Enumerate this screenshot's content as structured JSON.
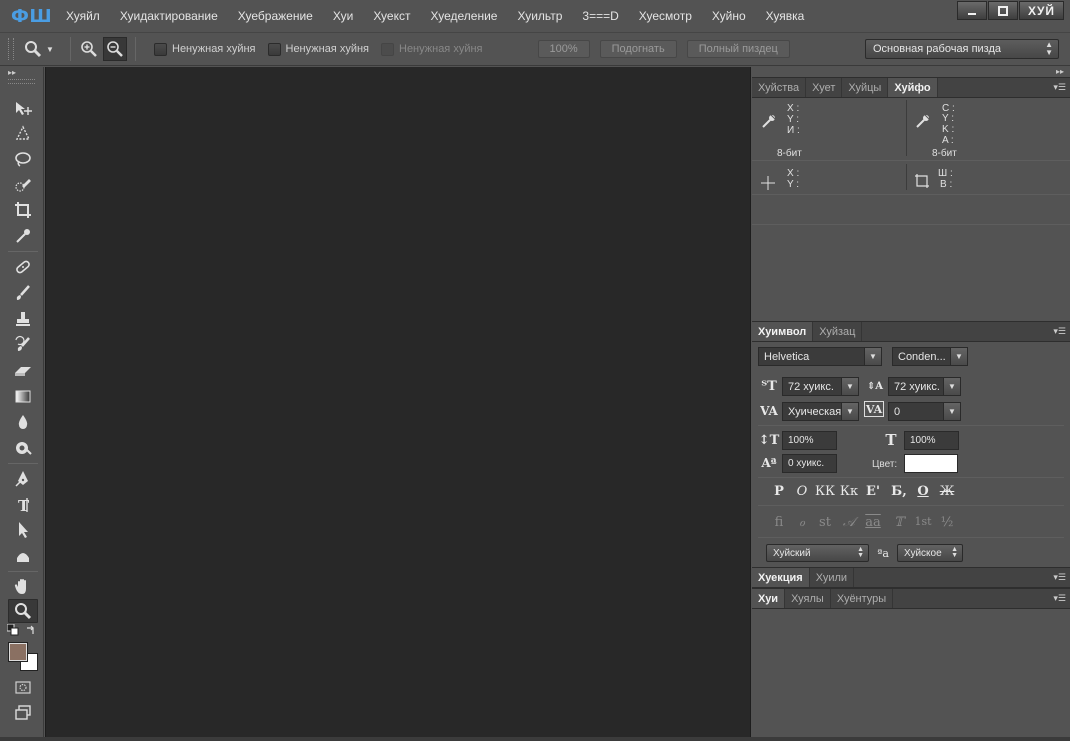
{
  "app": {
    "logo": "ФШ"
  },
  "menu": [
    "Хуяйл",
    "Хуидактирование",
    "Хуебражение",
    "Хуи",
    "Хуекст",
    "Хуеделение",
    "Хуильтр",
    "3===D",
    "Хуесмотр",
    "Хуйно",
    "Хуявка"
  ],
  "window": {
    "minimize": "▁",
    "maximize": "□",
    "close": "ХУЙ"
  },
  "options": {
    "checkbox1": "Ненужная хуйня",
    "checkbox2": "Ненужная хуйня",
    "checkbox3": "Ненужная хуйня",
    "zoom_value": "100%",
    "fit_button": "Подогнать",
    "full_button": "Полный пиздец",
    "workspace": "Основная рабочая пизда"
  },
  "info_panel": {
    "tabs": [
      "Хуйства",
      "Хует",
      "Хуйцы",
      "Хуйфо"
    ],
    "active_tab": 3,
    "left_labels": [
      "X :",
      "Y :",
      "И :"
    ],
    "right_labels": [
      "C :",
      "Y :",
      "K :",
      "A :"
    ],
    "bit_left": "8-бит",
    "bit_right": "8-бит",
    "pos_labels": [
      "X :",
      "Y :"
    ],
    "size_labels": [
      "Ш :",
      "В :"
    ]
  },
  "character_panel": {
    "tabs": [
      "Хуимвол",
      "Хуйзац"
    ],
    "font_family": "Helvetica",
    "font_style": "Conden...",
    "font_size": "72 хуикс.",
    "leading": "72 хуикс.",
    "kerning": "Хуическая",
    "tracking": "0",
    "vscale": "100%",
    "hscale": "100%",
    "baseline": "0 хуикс.",
    "color_label": "Цвет:",
    "color_value": "#ffffff",
    "styles_row1": [
      "Р",
      "О",
      "КК",
      "Кк",
      "Е'",
      "Б,",
      "О",
      "Ж"
    ],
    "styles_row2": [
      "fi",
      "ℴ",
      "st",
      "𝒜",
      "aa",
      "𝕋",
      "1st",
      "½"
    ],
    "language": "Хуйский",
    "aa_glyph": "ªa",
    "antialias": "Хуйское"
  },
  "layers_panel": {
    "tabs_top": [
      "Хуекция",
      "Хуили"
    ],
    "tabs_bottom": [
      "Хуи",
      "Хуялы",
      "Хуёнтуры"
    ]
  },
  "colors": {
    "foreground": "#8a7062",
    "background": "#ffffff",
    "logo": "#4a9de3"
  }
}
